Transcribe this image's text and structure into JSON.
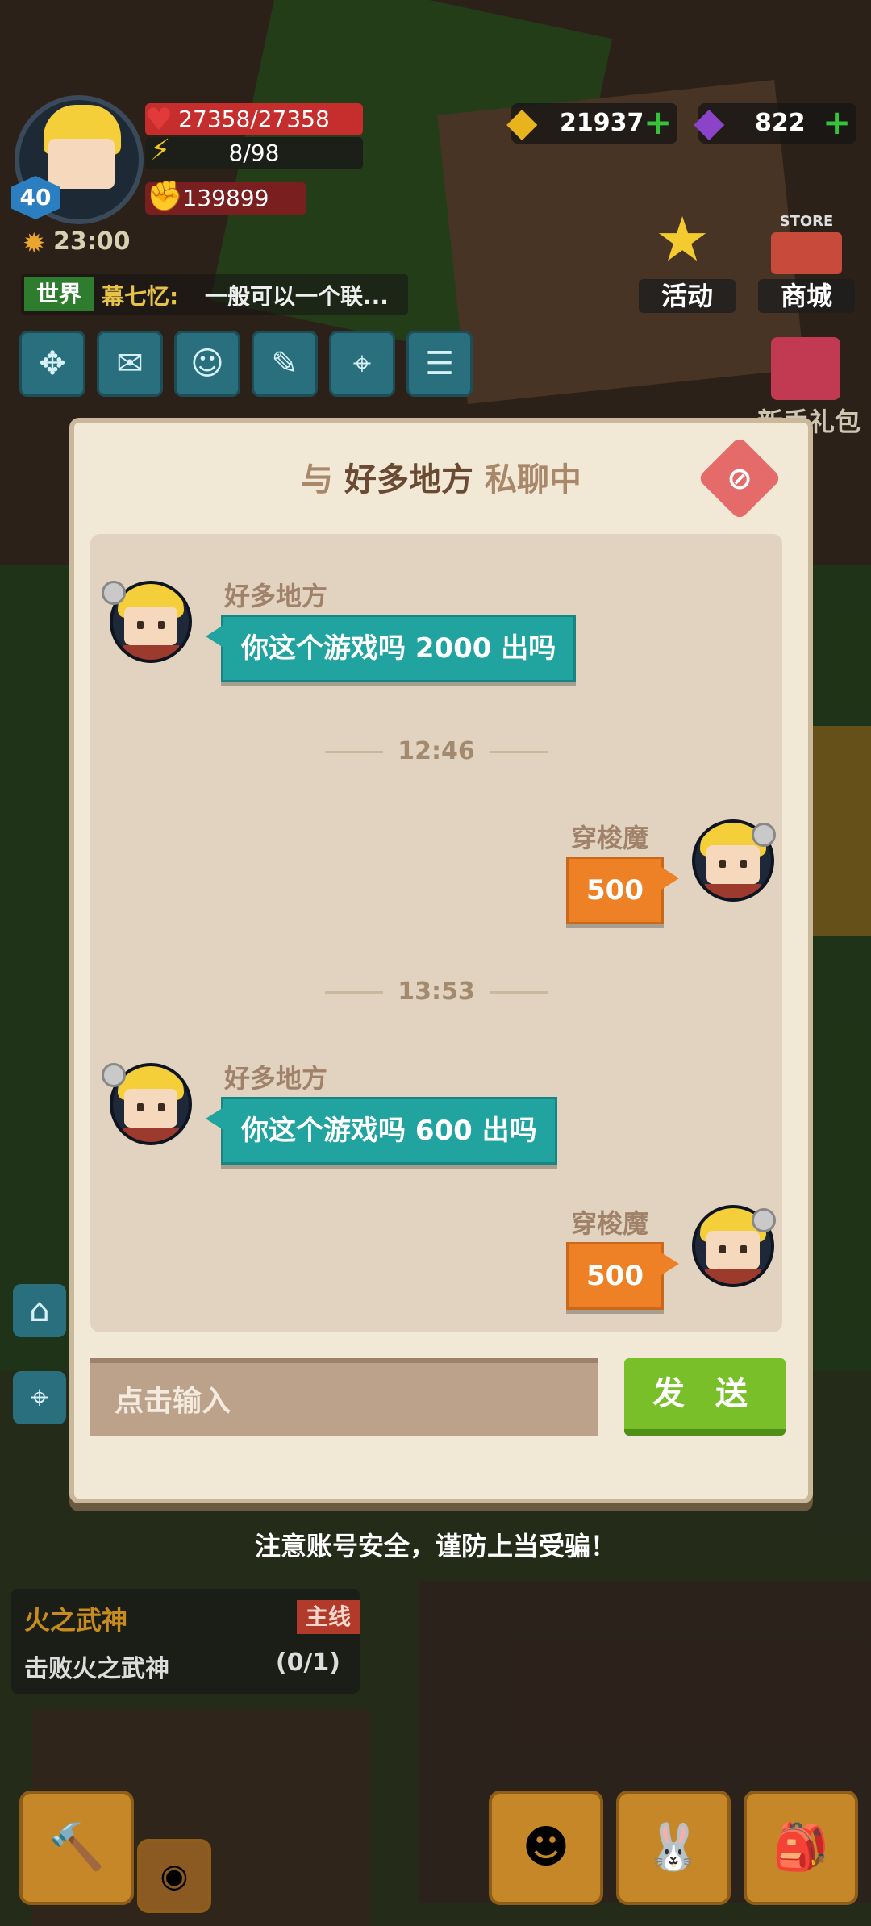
{
  "hud": {
    "level": "40",
    "hp": "27358/27358",
    "hp_fraction": 1.0,
    "energy": "8/98",
    "power": "139899",
    "time": "23:00",
    "gold": "21937",
    "gems": "822",
    "chat_channel": "世界",
    "chat_sender": "幕七忆:",
    "chat_preview": "一般可以一个联...",
    "activity_label": "活动",
    "store_label": "商城",
    "store_sign": "STORE",
    "gift_label": "新手礼包"
  },
  "dialog": {
    "title_prefix": "与",
    "partner_name": "好多地方",
    "title_suffix": "私聊中",
    "messages": [
      {
        "sender": "好多地方",
        "text": "你这个游戏吗 2000 出吗",
        "side": "left"
      },
      {
        "sender": "穿梭魔",
        "text": "500",
        "side": "right"
      },
      {
        "sender": "好多地方",
        "text": "你这个游戏吗 600 出吗",
        "side": "left"
      },
      {
        "sender": "穿梭魔",
        "text": "500",
        "side": "right"
      }
    ],
    "times": [
      "12:46",
      "13:53"
    ],
    "input_placeholder": "点击输入",
    "send_label": "发 送",
    "warning": "注意账号安全，谨防上当受骗！"
  },
  "quest": {
    "title": "火之武神",
    "tag": "主线",
    "description": "击败火之武神",
    "progress": "(0/1)"
  },
  "colors": {
    "teal_bubble": "#21a3a0",
    "orange_bubble": "#ee8125",
    "send_button": "#79bf2a",
    "dialog_bg": "#f1e8d6"
  }
}
